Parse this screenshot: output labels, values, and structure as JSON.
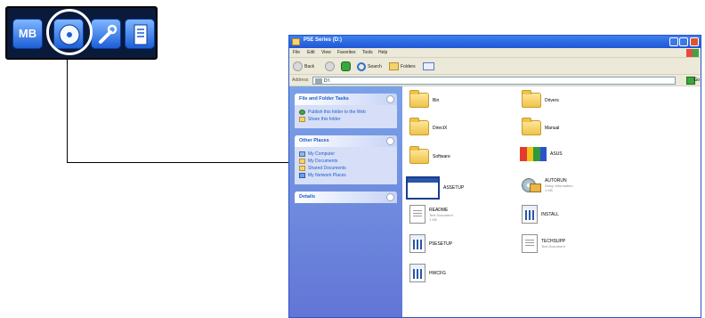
{
  "launcher": {
    "tiles": [
      {
        "name": "mb-tile",
        "label": "MB"
      },
      {
        "name": "drivers-disc-tile",
        "icon": "disc-icon"
      },
      {
        "name": "utilities-tile",
        "icon": "wrench-icon"
      },
      {
        "name": "manual-tile",
        "icon": "document-icon"
      }
    ],
    "highlight_color": "#ffffff"
  },
  "window": {
    "title": "P5E Series (D:)",
    "menu": [
      "File",
      "Edit",
      "View",
      "Favorites",
      "Tools",
      "Help"
    ],
    "toolbar": {
      "back": "Back",
      "search": "Search",
      "folders": "Folders"
    },
    "address": {
      "label": "Address",
      "value": "D:\\",
      "go": "Go"
    },
    "tasks": {
      "file_folder": {
        "header": "File and Folder Tasks",
        "items": [
          "Publish this folder to the Web",
          "Share this folder"
        ]
      },
      "other_places": {
        "header": "Other Places",
        "items": [
          "My Computer",
          "My Documents",
          "Shared Documents",
          "My Network Places"
        ]
      },
      "details": {
        "header": "Details"
      }
    },
    "files": [
      {
        "name": "Bin",
        "kind": "folder"
      },
      {
        "name": "Drivers",
        "kind": "folder"
      },
      {
        "name": "DirectX",
        "kind": "folder"
      },
      {
        "name": "Manual",
        "kind": "folder"
      },
      {
        "name": "Software",
        "kind": "folder"
      },
      {
        "name": "ASUS",
        "sub1": "",
        "sub2": "",
        "kind": "asus"
      },
      {
        "name": "ASSETUP",
        "kind": "window"
      },
      {
        "name": "AUTORUN",
        "sub1": "Setup Information",
        "sub2": "1 KB",
        "kind": "setup"
      },
      {
        "name": "README",
        "sub1": "Text Document",
        "sub2": "1 KB",
        "kind": "doc"
      },
      {
        "name": "INSTALL",
        "sub1": "",
        "sub2": "",
        "kind": "exe"
      },
      {
        "name": "P5ESETUP",
        "sub1": "",
        "sub2": "",
        "kind": "exe"
      },
      {
        "name": "TECHSUPP",
        "sub1": "Text Document",
        "sub2": "",
        "kind": "doc"
      },
      {
        "name": "HWCFG",
        "sub1": "",
        "sub2": "",
        "kind": "exe"
      }
    ]
  }
}
